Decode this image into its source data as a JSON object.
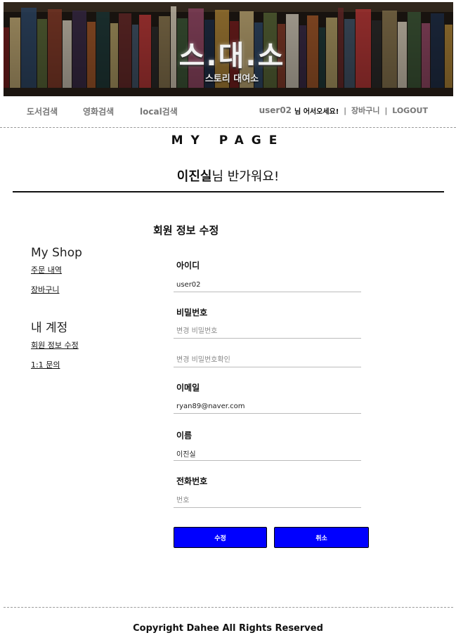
{
  "banner": {
    "logo_title": "스.대.소",
    "logo_subtitle": "스토리 대여소"
  },
  "nav": {
    "books": "도서검색",
    "movies": "영화검색",
    "local": "local검색",
    "user": "user02",
    "greeting": "님 어서오세요!",
    "cart": "장바구니",
    "logout": "LOGOUT"
  },
  "page": {
    "title": "MY PAGE",
    "welcome_name": "이진실",
    "welcome_suffix": "님 반가워요!"
  },
  "sidebar": {
    "shop_heading": "My Shop",
    "shop_links": [
      "주문 내역",
      "장바구니"
    ],
    "account_heading": "내 계정",
    "account_links": [
      "회원 정보 수정",
      "1:1 문의"
    ]
  },
  "form": {
    "title": "회원 정보 수정",
    "id_label": "아이디",
    "id_value": "user02",
    "pw_label": "비밀번호",
    "pw_placeholder": "변경 비밀번호",
    "pw_confirm_placeholder": "변경 비밀번호확인",
    "email_label": "이메일",
    "email_value": "ryan89@naver.com",
    "name_label": "이름",
    "name_value": "이진실",
    "phone_label": "전화번호",
    "phone_placeholder": "번호",
    "submit_label": "수정",
    "cancel_label": "취소"
  },
  "footer": {
    "copyright": "Copyright Dahee All Rights Reserved"
  },
  "colors": {
    "button_bg": "#0000ff",
    "banner_bg": "#1d1712"
  }
}
